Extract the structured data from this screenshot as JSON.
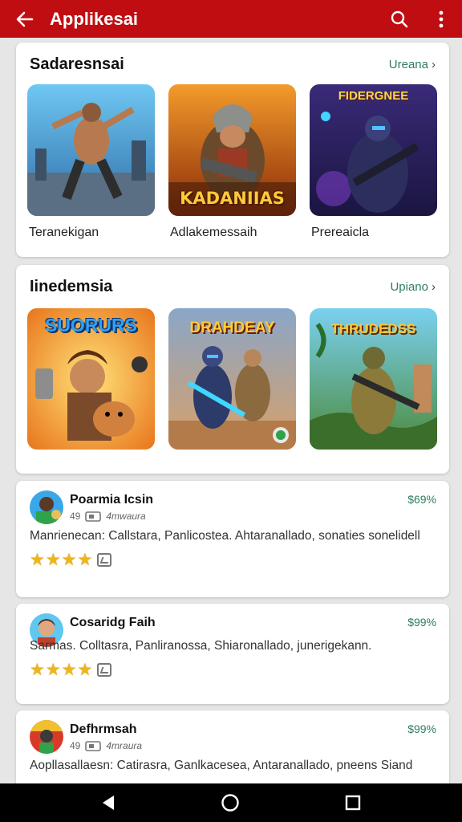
{
  "appbar": {
    "title": "Applikesai"
  },
  "sections": [
    {
      "title": "Sadaresnsai",
      "more": "Ureana",
      "items": [
        {
          "name": "Teranekigan",
          "art_text": ""
        },
        {
          "name": "Adlakemessaih",
          "art_text": "KADANIIAS"
        },
        {
          "name": "Prereaicla",
          "art_text": "FIDERGNEE"
        }
      ]
    },
    {
      "title": "Iinedemsia",
      "more": "Upiano",
      "items": [
        {
          "art_text": "SUORURS"
        },
        {
          "art_text": "DRAHDEAY"
        },
        {
          "art_text": "THRUDEDSS"
        }
      ]
    }
  ],
  "apps": [
    {
      "name": "Poarmia Icsin",
      "rating_num": "49",
      "sub": "4mwaura",
      "price": "$69%",
      "desc": "Manrienecan: Callstara, Panlicostea. Ahtaranallado, sonaties sonelidell"
    },
    {
      "name": "Cosaridg Faih",
      "price": "$99%",
      "desc": "Sarmas. Colltasra, Panliranossa, Shiaronallado, junerigekann."
    },
    {
      "name": "Defhrmsah",
      "rating_num": "49",
      "sub": "4mraura",
      "price": "$99%",
      "desc": "Aopllasallaesn: Catirasra, Ganlkacesea, Antaranallado, pneens Siand"
    }
  ],
  "colors": {
    "appbar": "#c00d12",
    "link": "#2e7d5b",
    "star": "#f0b51a"
  }
}
